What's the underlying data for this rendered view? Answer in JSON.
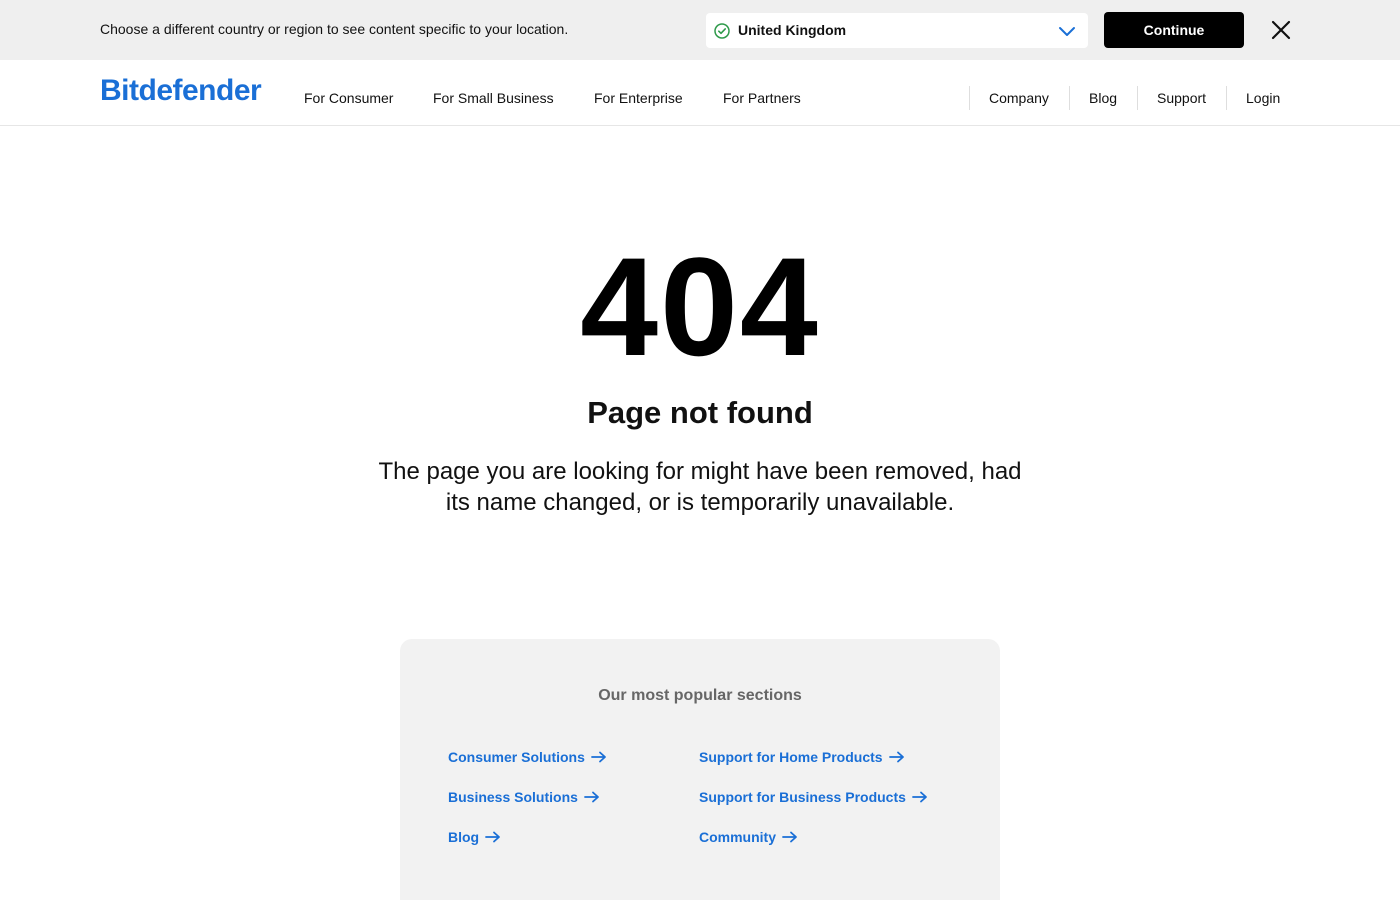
{
  "region_banner": {
    "message": "Choose a different country or region to see content specific to your location.",
    "selected_country": "United Kingdom",
    "continue_label": "Continue",
    "icons": {
      "check": "check-circle-icon",
      "dropdown": "chevron-down-icon",
      "close": "close-icon"
    }
  },
  "header": {
    "logo": "Bitdefender",
    "primary_nav": [
      "For Consumer",
      "For Small Business",
      "For Enterprise",
      "For Partners"
    ],
    "secondary_nav": [
      "Company",
      "Blog",
      "Support",
      "Login"
    ]
  },
  "main": {
    "error_code": "404",
    "heading": "Page not found",
    "description": "The page you are looking for might have been removed, had its name changed, or is temporarily unavailable."
  },
  "popular": {
    "title": "Our most popular sections",
    "links": [
      "Consumer Solutions",
      "Support for Home Products",
      "Business Solutions",
      "Support for Business Products",
      "Blog",
      "Community"
    ]
  },
  "colors": {
    "brand_blue": "#1a6fd6",
    "banner_bg": "#efefef",
    "button_bg": "#000000",
    "check_green": "#2e9a4a",
    "card_bg": "#f2f2f2"
  }
}
